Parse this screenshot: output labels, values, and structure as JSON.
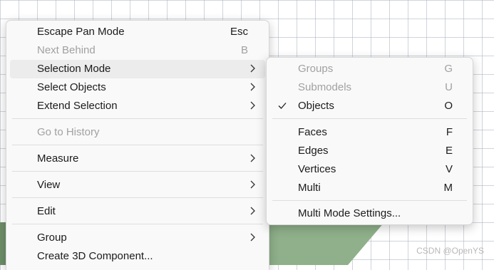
{
  "main_menu": {
    "escape_pan_mode": {
      "label": "Escape Pan Mode",
      "shortcut": "Esc"
    },
    "next_behind": {
      "label": "Next Behind",
      "shortcut": "B"
    },
    "selection_mode": {
      "label": "Selection Mode"
    },
    "select_objects": {
      "label": "Select Objects"
    },
    "extend_selection": {
      "label": "Extend Selection"
    },
    "go_to_history": {
      "label": "Go to History"
    },
    "measure": {
      "label": "Measure"
    },
    "view": {
      "label": "View"
    },
    "edit": {
      "label": "Edit"
    },
    "group": {
      "label": "Group"
    },
    "create_3d_component": {
      "label": "Create 3D Component..."
    }
  },
  "submenu": {
    "groups": {
      "label": "Groups",
      "shortcut": "G"
    },
    "submodels": {
      "label": "Submodels",
      "shortcut": "U"
    },
    "objects": {
      "label": "Objects",
      "shortcut": "O"
    },
    "faces": {
      "label": "Faces",
      "shortcut": "F"
    },
    "edges": {
      "label": "Edges",
      "shortcut": "E"
    },
    "vertices": {
      "label": "Vertices",
      "shortcut": "V"
    },
    "multi": {
      "label": "Multi",
      "shortcut": "M"
    },
    "multi_mode_settings": {
      "label": "Multi Mode Settings..."
    }
  },
  "watermark": "CSDN @OpenYS",
  "icons": {
    "submenu_arrow": "chevron-right-icon",
    "checked": "checkmark-icon"
  },
  "colors": {
    "menu_bg": "#f9f9f9",
    "highlight": "#ececec",
    "text": "#1b1b1b",
    "disabled_text": "#a1a1a1"
  }
}
